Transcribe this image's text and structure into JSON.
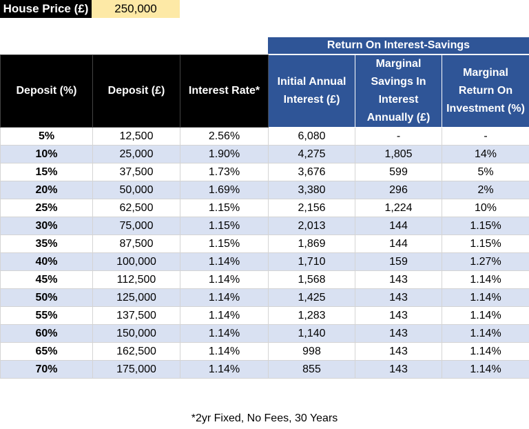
{
  "house_price": {
    "label": "House Price (£)",
    "value": "250,000"
  },
  "section_header": "Return On Interest-Savings",
  "columns": [
    "Deposit (%)",
    "Deposit (£)",
    "Interest Rate*",
    "Initial Annual Interest (£)",
    "Marginal Savings In Interest Annually (£)",
    "Marginal Return On Investment (%)"
  ],
  "rows": [
    [
      "5%",
      "12,500",
      "2.56%",
      "6,080",
      "-",
      "-"
    ],
    [
      "10%",
      "25,000",
      "1.90%",
      "4,275",
      "1,805",
      "14%"
    ],
    [
      "15%",
      "37,500",
      "1.73%",
      "3,676",
      "599",
      "5%"
    ],
    [
      "20%",
      "50,000",
      "1.69%",
      "3,380",
      "296",
      "2%"
    ],
    [
      "25%",
      "62,500",
      "1.15%",
      "2,156",
      "1,224",
      "10%"
    ],
    [
      "30%",
      "75,000",
      "1.15%",
      "2,013",
      "144",
      "1.15%"
    ],
    [
      "35%",
      "87,500",
      "1.15%",
      "1,869",
      "144",
      "1.15%"
    ],
    [
      "40%",
      "100,000",
      "1.14%",
      "1,710",
      "159",
      "1.27%"
    ],
    [
      "45%",
      "112,500",
      "1.14%",
      "1,568",
      "143",
      "1.14%"
    ],
    [
      "50%",
      "125,000",
      "1.14%",
      "1,425",
      "143",
      "1.14%"
    ],
    [
      "55%",
      "137,500",
      "1.14%",
      "1,283",
      "143",
      "1.14%"
    ],
    [
      "60%",
      "150,000",
      "1.14%",
      "1,140",
      "143",
      "1.14%"
    ],
    [
      "65%",
      "162,500",
      "1.14%",
      "998",
      "143",
      "1.14%"
    ],
    [
      "70%",
      "175,000",
      "1.14%",
      "855",
      "143",
      "1.14%"
    ]
  ],
  "footnote": "*2yr Fixed, No Fees, 30 Years",
  "colors": {
    "header_dark": "#000000",
    "header_blue": "#2f5597",
    "price_highlight": "#fde9a6",
    "row_alt": "#d9e1f2"
  }
}
